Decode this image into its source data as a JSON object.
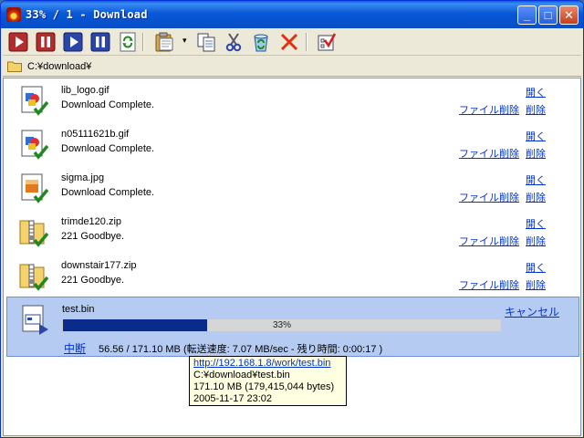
{
  "window": {
    "title": "33% / 1 - Download",
    "controls": {
      "minimize": "_",
      "maximize": "□",
      "close": "✕"
    }
  },
  "toolbar": {
    "tools": [
      {
        "name": "start-icon"
      },
      {
        "name": "pause-icon"
      },
      {
        "name": "start-all-icon"
      },
      {
        "name": "pause-all-icon"
      },
      {
        "name": "refresh-icon"
      },
      {
        "name": "paste-url-icon"
      },
      {
        "name": "copy-icon"
      },
      {
        "name": "cut-icon"
      },
      {
        "name": "recycle-icon"
      },
      {
        "name": "delete-icon"
      },
      {
        "name": "settings-icon"
      }
    ],
    "paste_menu_arrow": "▾"
  },
  "path": {
    "value": "C:¥download¥"
  },
  "files": [
    {
      "name": "lib_logo.gif",
      "status": "Download Complete.",
      "type": "image",
      "open": "開く",
      "delete": "削除",
      "file_delete": "ファイル削除"
    },
    {
      "name": "n05111621b.gif",
      "status": "Download Complete.",
      "type": "image",
      "open": "開く",
      "delete": "削除",
      "file_delete": "ファイル削除"
    },
    {
      "name": "sigma.jpg",
      "status": "Download Complete.",
      "type": "photo",
      "open": "開く",
      "delete": "削除",
      "file_delete": "ファイル削除"
    },
    {
      "name": "trimde120.zip",
      "status": "221 Goodbye.",
      "type": "zip",
      "open": "開く",
      "delete": "削除",
      "file_delete": "ファイル削除"
    },
    {
      "name": "downstair177.zip",
      "status": "221 Goodbye.",
      "type": "zip",
      "open": "開く",
      "delete": "削除",
      "file_delete": "ファイル削除"
    }
  ],
  "active": {
    "name": "test.bin",
    "cancel": "キャンセル",
    "progress_percent": 33,
    "progress_label": "33%",
    "pause": "中断",
    "stats": "56.56 / 171.10 MB (転送速度: 7.07 MB/sec - 残り時間: 0:00:17 )"
  },
  "tooltip": {
    "url": "http://192.168.1.8/work/test.bin",
    "path": "C:¥download¥test.bin",
    "size": "171.10 MB (179,415,044 bytes)",
    "date": "2005-11-17 23:02"
  },
  "colors": {
    "titlebar": "#0a58d6",
    "link": "#0033cc",
    "progress_fill": "#0a2a8c",
    "active_row": "#b5cbf2",
    "check_mark": "#1e8a1e"
  }
}
